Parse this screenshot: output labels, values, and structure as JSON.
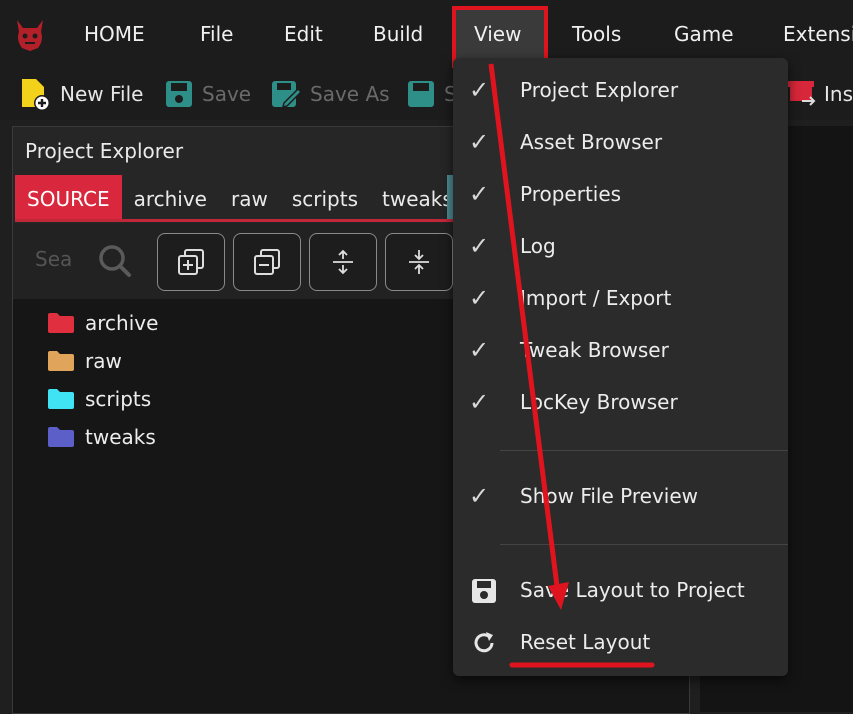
{
  "menubar": {
    "items": [
      "HOME",
      "File",
      "Edit",
      "Build",
      "View",
      "Tools",
      "Game",
      "Extensio"
    ]
  },
  "toolbar": {
    "new_file": "New File",
    "save": "Save",
    "save_as": "Save As",
    "save_all": "S",
    "install": "Ins"
  },
  "project_explorer": {
    "title": "Project Explorer",
    "tabs": [
      "SOURCE",
      "archive",
      "raw",
      "scripts",
      "tweaks"
    ],
    "active_tab": "SOURCE",
    "search_placeholder": "Sea",
    "folders": [
      {
        "label": "archive",
        "color": "#e03040"
      },
      {
        "label": "raw",
        "color": "#e0a45a"
      },
      {
        "label": "scripts",
        "color": "#3fe3f4"
      },
      {
        "label": "tweaks",
        "color": "#5b5fc7"
      }
    ]
  },
  "view_menu": {
    "items": [
      {
        "label": "Project Explorer",
        "checked": true
      },
      {
        "label": "Asset Browser",
        "checked": true
      },
      {
        "label": "Properties",
        "checked": true
      },
      {
        "label": "Log",
        "checked": true
      },
      {
        "label": "Import / Export",
        "checked": true
      },
      {
        "label": "Tweak Browser",
        "checked": true
      },
      {
        "label": "LocKey Browser",
        "checked": true
      }
    ],
    "show_file_preview": {
      "label": "Show File Preview",
      "checked": true
    },
    "save_layout": "Save Layout to Project",
    "reset_layout": "Reset Layout",
    "check_glyph": "✓"
  },
  "colors": {
    "accent_red": "#e0141e",
    "active_tab": "#d9283d"
  }
}
